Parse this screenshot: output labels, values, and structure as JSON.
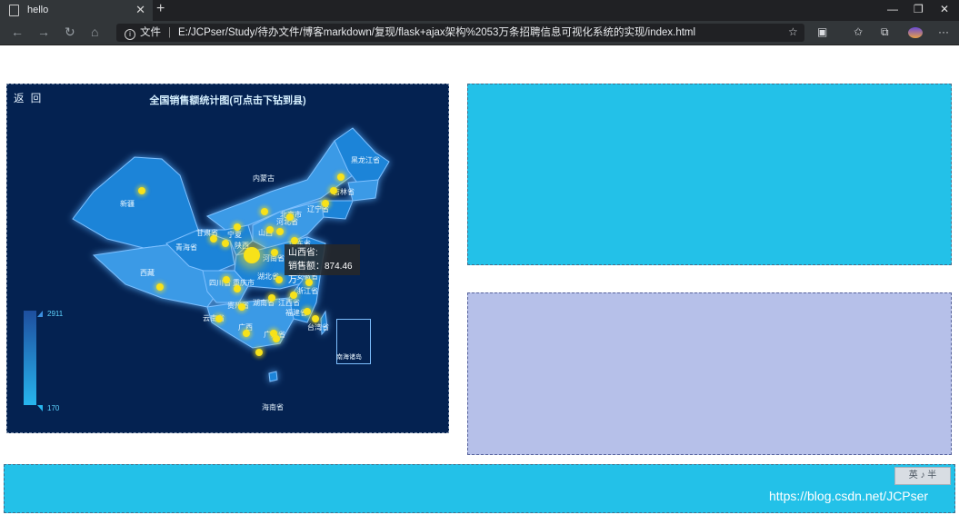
{
  "browser": {
    "tab_title": "hello",
    "new_tab_symbol": "+",
    "address_prefix": "文件",
    "url": "E:/JCPser/Study/待办文件/博客markdown/复现/flask+ajax架构%2053万条招聘信息可视化系统的实现/index.html",
    "icons": [
      "page-icon",
      "back-icon",
      "forward-icon",
      "refresh-icon",
      "home-icon",
      "info-icon",
      "star-icon",
      "favorites-icon",
      "collections-icon",
      "more-icon"
    ]
  },
  "map": {
    "title": "全国销售额统计图(可点击下钻到县)",
    "back_label": "返 回",
    "tooltip_province": "山西省:",
    "tooltip_value": "销售额：874.46万",
    "legend_max": "2911",
    "legend_min": "170",
    "labels": [
      "黑龙江省",
      "内蒙古",
      "吉林省",
      "辽宁省",
      "新疆",
      "北京市",
      "河北省",
      "甘肃省",
      "宁夏",
      "山西",
      "山东省",
      "青海省",
      "陕西",
      "河南省",
      "西藏",
      "四川省",
      "湖北省",
      "重庆市",
      "安徽省",
      "浙江省",
      "湖南省",
      "江西省",
      "贵州省",
      "福建省",
      "云南省",
      "广西",
      "广东省",
      "台湾省",
      "南海诸岛",
      "海南省"
    ]
  },
  "colors": {
    "map_bg": "#042251",
    "province_fill": "#1f84d8",
    "highlight_dot": "#f7e21a",
    "panel_cyan": "#23c1e8",
    "panel_lavender": "#b6c0e9"
  },
  "ime": {
    "label": "英 ♪ 半"
  },
  "watermark": "https://blog.csdn.net/JCPser"
}
